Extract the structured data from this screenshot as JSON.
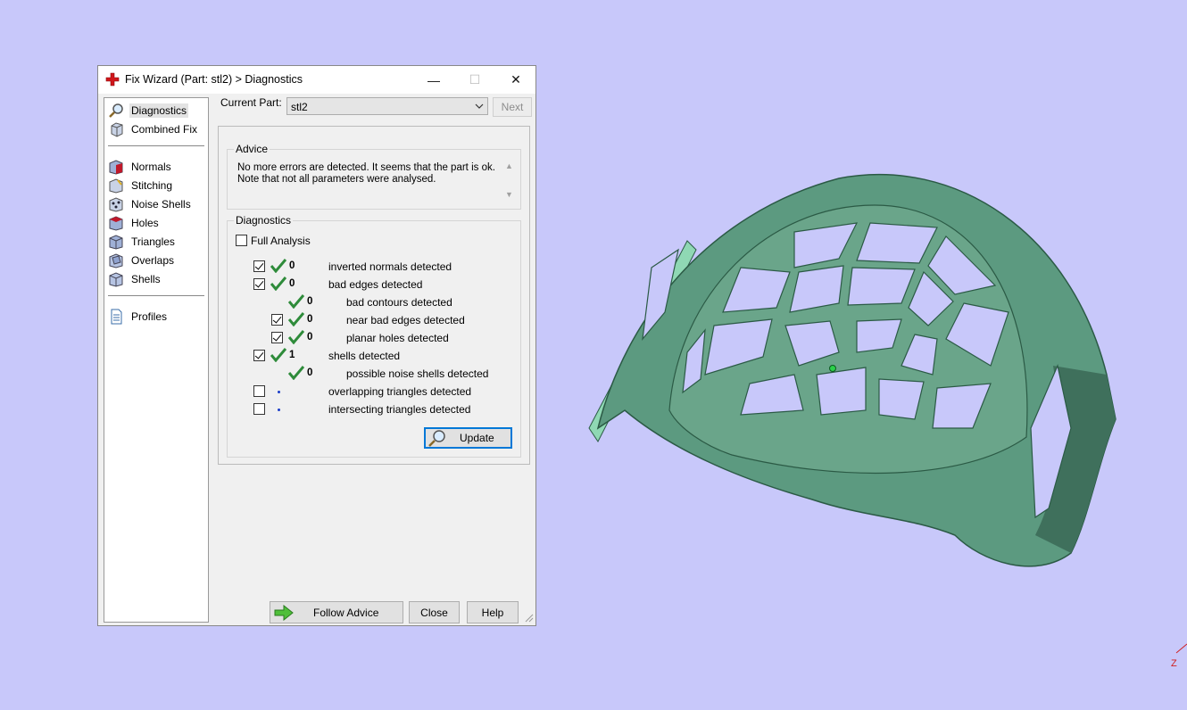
{
  "dialog": {
    "title": "Fix Wizard (Part: stl2) > Diagnostics",
    "window_buttons": {
      "minimize": "—",
      "maximize": "☐",
      "close": "✕"
    }
  },
  "sidebar": {
    "items": [
      {
        "label": "Diagnostics",
        "icon": "magnifier-icon",
        "selected": true
      },
      {
        "label": "Combined Fix",
        "icon": "cube-icon"
      },
      {
        "label": "Normals",
        "icon": "normals-cube-icon"
      },
      {
        "label": "Stitching",
        "icon": "stitching-cube-icon"
      },
      {
        "label": "Noise Shells",
        "icon": "noise-shells-icon"
      },
      {
        "label": "Holes",
        "icon": "holes-cube-icon"
      },
      {
        "label": "Triangles",
        "icon": "triangles-cube-icon"
      },
      {
        "label": "Overlaps",
        "icon": "overlaps-cube-icon"
      },
      {
        "label": "Shells",
        "icon": "shells-cube-icon"
      },
      {
        "label": "Profiles",
        "icon": "document-icon"
      }
    ]
  },
  "toolbar": {
    "current_part_label": "Current Part:",
    "current_part_value": "stl2",
    "next_label": "Next"
  },
  "advice": {
    "title": "Advice",
    "line1": "No more errors are detected. It seems that the part is ok.",
    "line2": "Note that not all parameters were analysed."
  },
  "diagnostics": {
    "title": "Diagnostics",
    "full_analysis_label": "Full Analysis",
    "rows": [
      {
        "count": "0",
        "label": "inverted normals detected"
      },
      {
        "count": "0",
        "label": "bad edges detected"
      },
      {
        "count": "0",
        "label": "bad contours detected"
      },
      {
        "count": "0",
        "label": "near bad edges detected"
      },
      {
        "count": "0",
        "label": "planar holes detected"
      },
      {
        "count": "1",
        "label": "shells detected"
      },
      {
        "count": "0",
        "label": "possible noise shells detected"
      },
      {
        "count": "",
        "label": "overlapping triangles detected"
      },
      {
        "count": "",
        "label": "intersecting triangles detected"
      }
    ],
    "update_label": "Update"
  },
  "footer": {
    "follow_advice_label": "Follow Advice",
    "close_label": "Close",
    "help_label": "Help"
  },
  "viewport": {
    "axis_label": "Z",
    "background_color": "#c8c8fa",
    "model_color": "#6aa58a"
  }
}
